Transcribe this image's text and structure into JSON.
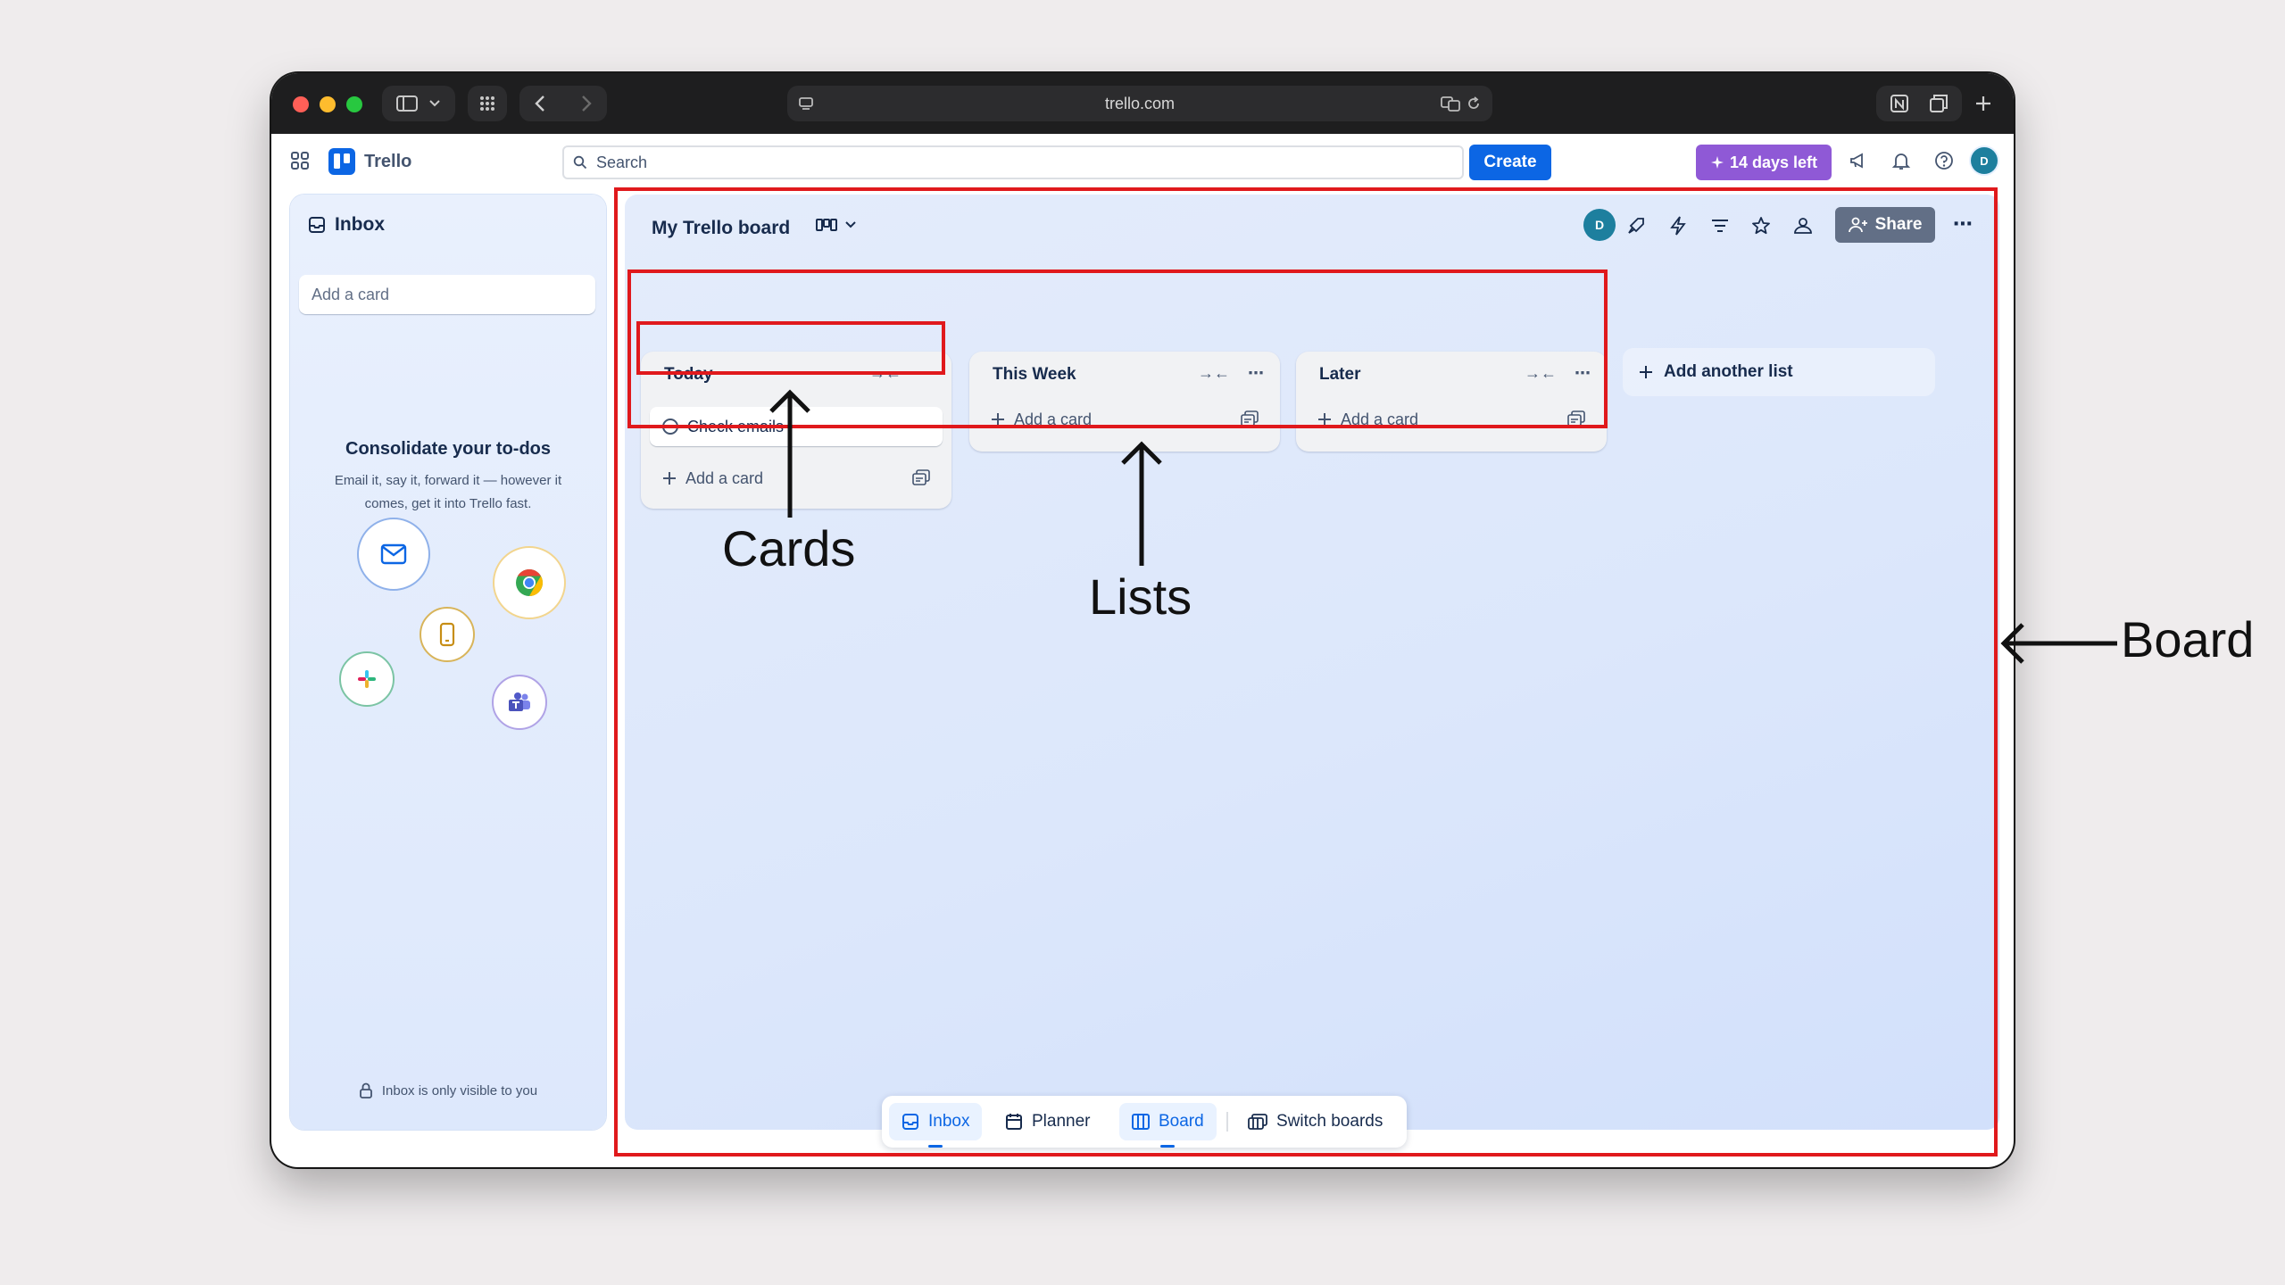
{
  "browser": {
    "url": "trello.com",
    "traffic_lights": [
      "#ff5f57",
      "#febc2e",
      "#28c840"
    ]
  },
  "app": {
    "name": "Trello",
    "search_placeholder": "Search",
    "create_label": "Create",
    "trial_label": "14 days left",
    "avatar_initial": "D",
    "brand_color": "#0c66e4",
    "trial_color": "#8f59d6"
  },
  "inbox": {
    "title": "Inbox",
    "add_card_placeholder": "Add a card",
    "promo_title": "Consolidate your to-dos",
    "promo_text": "Email it, say it, forward it — however it comes, get it into Trello fast.",
    "integrations": [
      "mail-icon",
      "chrome-icon",
      "mobile-icon",
      "slack-icon",
      "teams-icon"
    ],
    "privacy_note": "Inbox is only visible to you"
  },
  "board": {
    "title": "My Trello board",
    "share_label": "Share",
    "member_initial": "D",
    "lists": [
      {
        "title": "Today",
        "cards": [
          {
            "title": "Check emails"
          }
        ],
        "add_label": "Add a card"
      },
      {
        "title": "This Week",
        "cards": [],
        "add_label": "Add a card"
      },
      {
        "title": "Later",
        "cards": [],
        "add_label": "Add a card"
      }
    ],
    "add_list_label": "Add another list"
  },
  "bottom_nav": {
    "items": [
      {
        "label": "Inbox",
        "active": true
      },
      {
        "label": "Planner",
        "active": false
      },
      {
        "label": "Board",
        "active": true
      },
      {
        "label": "Switch boards",
        "active": false
      }
    ]
  },
  "annotations": {
    "cards": "Cards",
    "lists": "Lists",
    "board": "Board",
    "highlight_color": "#e0191c"
  }
}
